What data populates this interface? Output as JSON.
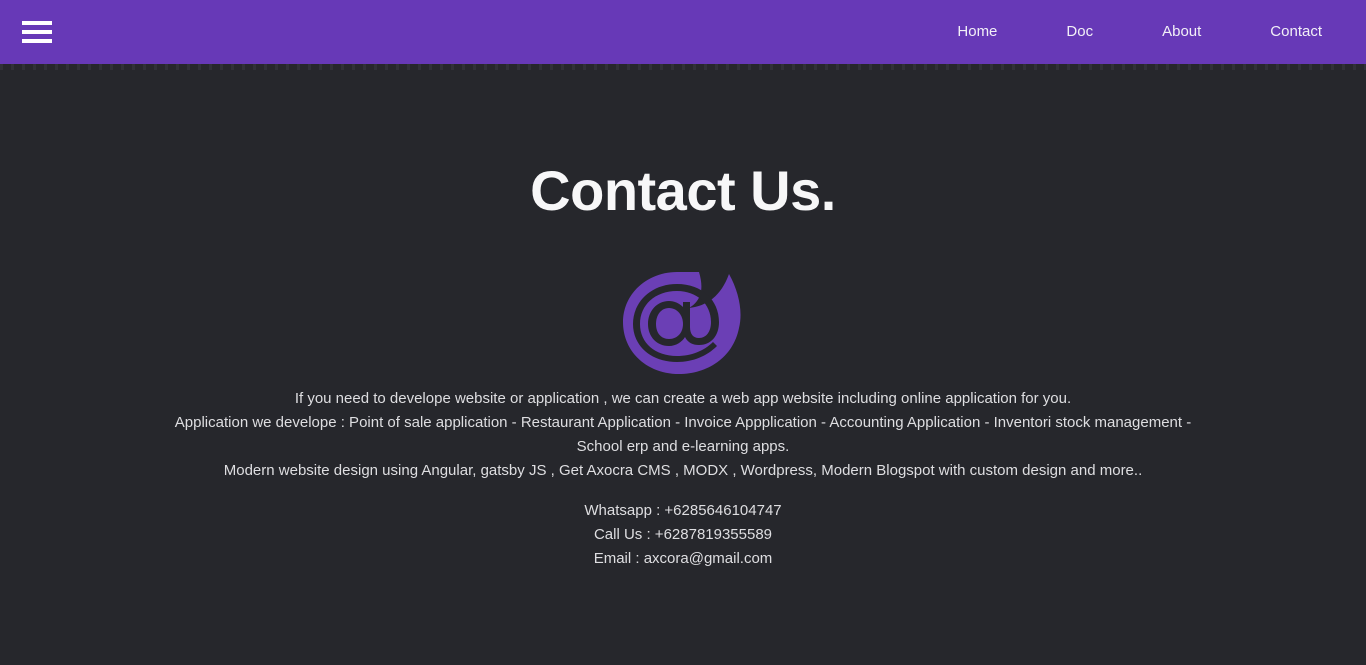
{
  "theme": {
    "header_bg": "#6739b7",
    "page_bg": "#26272c",
    "text_color": "#dedee1",
    "heading_color": "#f7f7f8",
    "logo_color": "#6b3fb5"
  },
  "header": {
    "menu_icon": "hamburger-menu-icon",
    "nav_items": [
      {
        "label": "Home"
      },
      {
        "label": "Doc"
      },
      {
        "label": "About"
      },
      {
        "label": "Contact"
      }
    ]
  },
  "main": {
    "title": "Contact Us.",
    "logo_icon": "at-sign-flame-logo",
    "description_lines": [
      "If you need to develope website or application , we can create a web app website including online application for you.",
      "Application we develope : Point of sale application - Restaurant Application - Invoice Appplication - Accounting Application - Inventori stock management - School erp and e-learning apps.",
      "Modern website design using Angular, gatsby JS , Get Axocra CMS , MODX , Wordpress, Modern Blogspot with custom design and more.."
    ],
    "contact_lines": [
      "Whatsapp : +6285646104747",
      "Call Us : +6287819355589",
      "Email : axcora@gmail.com"
    ]
  }
}
